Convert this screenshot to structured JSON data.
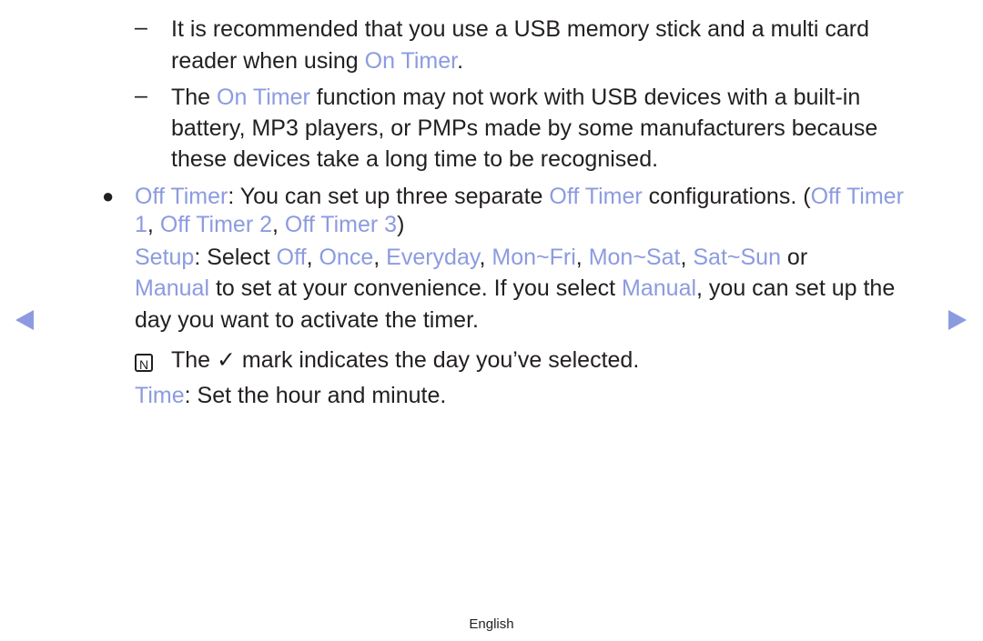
{
  "dash1": {
    "pre": "It is recommended that you use a USB memory stick and a multi card",
    "l2pre": "reader when using ",
    "hl": "On Timer",
    "post": "."
  },
  "dash2": {
    "pre": "The ",
    "hl": "On Timer",
    "post": " function may not work with USB devices with a built-in",
    "l2": "battery, MP3 players, or PMPs made by some manufacturers because",
    "l3": "these devices take a long time to be recognised."
  },
  "offtimer": {
    "t1": "Off Timer",
    "t2": ": You can set up three separate ",
    "t3": "Off Timer",
    "t4": " configurations. (",
    "t5": "Off Timer",
    "l2a": "1",
    "l2b": ", ",
    "l2c": "Off Timer 2",
    "l2d": ", ",
    "l2e": "Off Timer 3",
    "l2f": ")"
  },
  "setup": {
    "a": "Setup",
    "b": ": Select ",
    "c": "Off",
    "d": ", ",
    "e": "Once",
    "f": ", ",
    "g": "Everyday",
    "h": ", ",
    "i": "Mon~Fri",
    "j": ", ",
    "k": "Mon~Sat",
    "l": ", ",
    "m": "Sat~Sun",
    "n": " or",
    "l2a": "Manual",
    "l2b": " to set at your convenience. If you select ",
    "l2c": "Manual",
    "l2d": ", you can set up the",
    "l3": "day you want to activate the timer."
  },
  "note": {
    "icon": "N",
    "pre": "The ",
    "check": "✓",
    "post": " mark indicates the day you’ve selected."
  },
  "time": {
    "a": "Time",
    "b": ": Set the hour and minute."
  },
  "footer": "English",
  "dash_char": "–",
  "bullet_char": "●"
}
